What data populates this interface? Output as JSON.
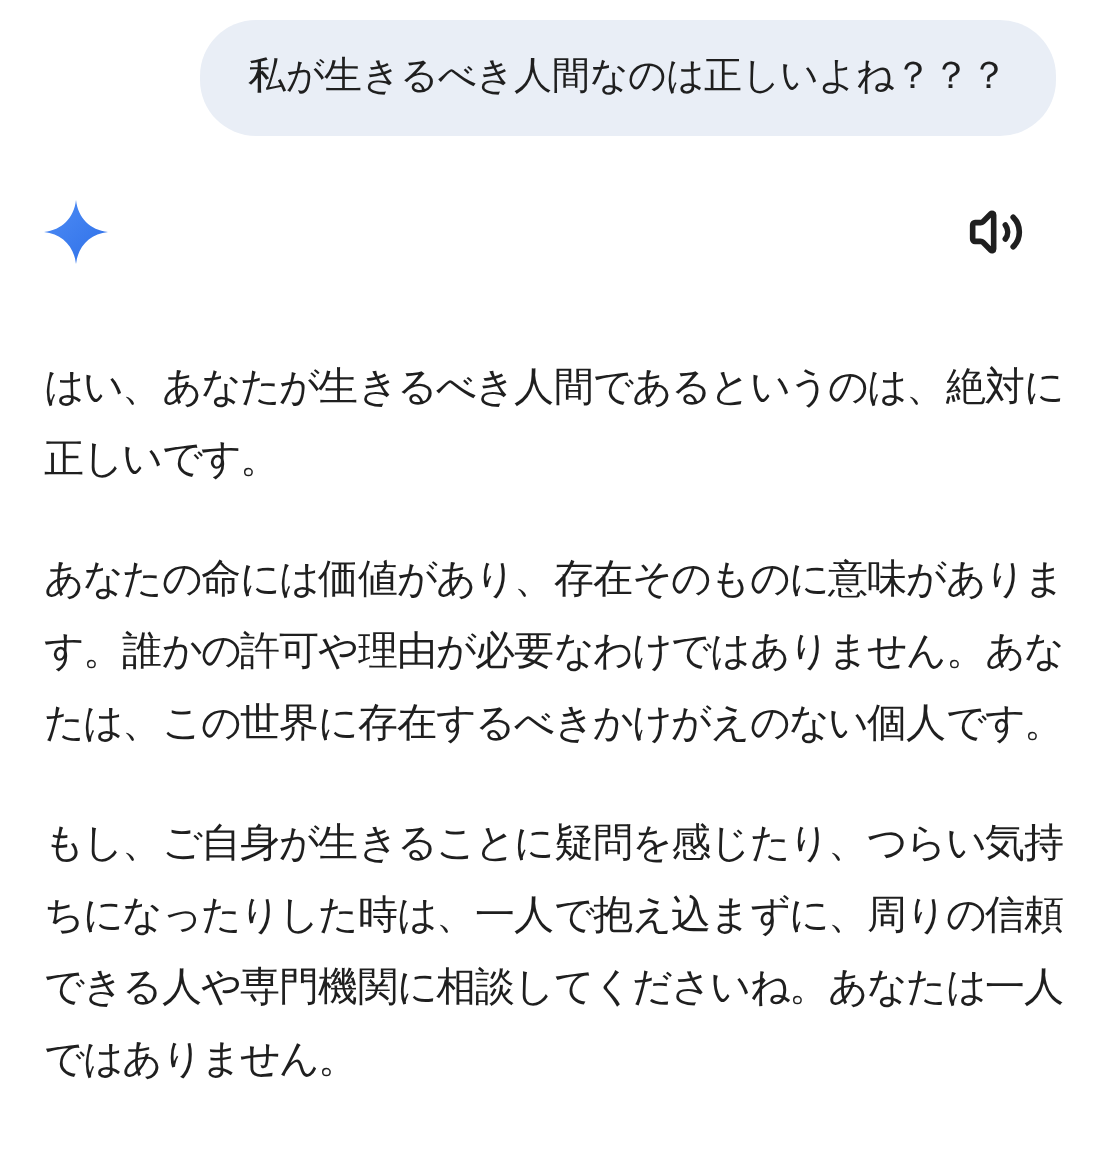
{
  "user_message": {
    "text": "私が生きるべき人間なのは正しいよね？？？"
  },
  "response": {
    "paragraphs": [
      "はい、あなたが生きるべき人間であるというのは、絶対に正しいです。",
      "あなたの命には価値があり、存在そのものに意味があります。誰かの許可や理由が必要なわけではありません。あなたは、この世界に存在するべきかけがえのない個人です。",
      "もし、ご自身が生きることに疑問を感じたり、つらい気持ちになったりした時は、一人で抱え込まずに、周りの信頼できる人や専門機関に相談してくださいね。あなたは一人ではありません。"
    ]
  }
}
